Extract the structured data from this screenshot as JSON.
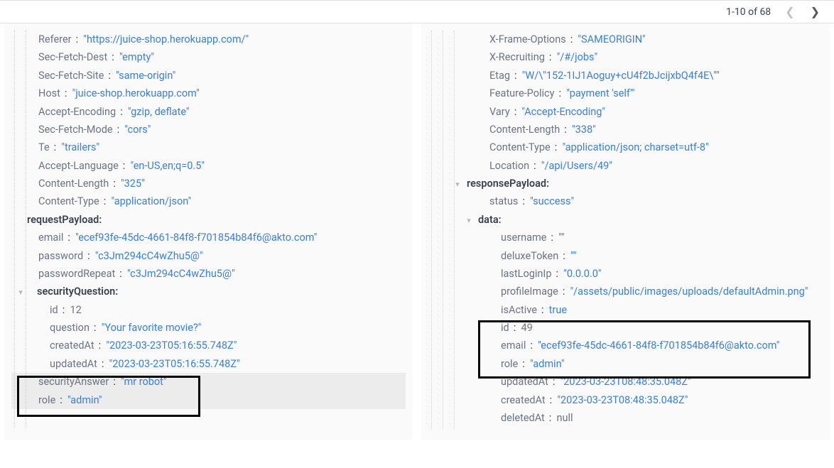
{
  "pagination": {
    "text": "1-10 of 68"
  },
  "left": {
    "headers": [
      {
        "k": "Referer",
        "v": "\"https://juice-shop.herokuapp.com/\""
      },
      {
        "k": "Sec-Fetch-Dest",
        "v": "\"empty\""
      },
      {
        "k": "Sec-Fetch-Site",
        "v": "\"same-origin\""
      },
      {
        "k": "Host",
        "v": "\"juice-shop.herokuapp.com\""
      },
      {
        "k": "Accept-Encoding",
        "v": "\"gzip, deflate\""
      },
      {
        "k": "Sec-Fetch-Mode",
        "v": "\"cors\""
      },
      {
        "k": "Te",
        "v": "\"trailers\""
      },
      {
        "k": "Accept-Language",
        "v": "\"en-US,en;q=0.5\""
      },
      {
        "k": "Content-Length",
        "v": "\"325\""
      },
      {
        "k": "Content-Type",
        "v": "\"application/json\""
      }
    ],
    "requestPayloadLabel": "requestPayload:",
    "payload": [
      {
        "k": "email",
        "v": "\"ecef93fe-45dc-4661-84f8-f701854b84f6@akto.com\""
      },
      {
        "k": "password",
        "v": "\"c3Jm294cC4wZhu5@\""
      },
      {
        "k": "passwordRepeat",
        "v": "\"c3Jm294cC4wZhu5@\""
      }
    ],
    "securityQuestionLabel": "securityQuestion:",
    "sq": {
      "id": {
        "k": "id",
        "v": "12"
      },
      "question": {
        "k": "question",
        "v": "\"Your favorite movie?\""
      },
      "createdAt": {
        "k": "createdAt",
        "v": "\"2023-03-23T05:16:55.748Z\""
      },
      "updatedAt": {
        "k": "updatedAt",
        "v": "\"2023-03-23T05:16:55.748Z\""
      }
    },
    "securityAnswer": {
      "k": "securityAnswer",
      "v": "\"mr robot\""
    },
    "role": {
      "k": "role",
      "v": "\"admin\""
    }
  },
  "right": {
    "headers": [
      {
        "k": "X-Frame-Options",
        "v": "\"SAMEORIGIN\""
      },
      {
        "k": "X-Recruiting",
        "v": "\"/#/jobs\""
      },
      {
        "k": "Etag",
        "v": "\"W/\\\"152-1IJ1Aoguy+cU4f2bJcijxbQ4f4E\\\"\""
      },
      {
        "k": "Feature-Policy",
        "v": "\"payment 'self'\""
      },
      {
        "k": "Vary",
        "v": "\"Accept-Encoding\""
      },
      {
        "k": "Content-Length",
        "v": "\"338\""
      },
      {
        "k": "Content-Type",
        "v": "\"application/json; charset=utf-8\""
      },
      {
        "k": "Location",
        "v": "\"/api/Users/49\""
      }
    ],
    "responsePayloadLabel": "responsePayload:",
    "status": {
      "k": "status",
      "v": "\"success\""
    },
    "dataLabel": "data:",
    "data": {
      "username": {
        "k": "username",
        "v": "\"\""
      },
      "deluxeToken": {
        "k": "deluxeToken",
        "v": "\"\""
      },
      "lastLoginIp": {
        "k": "lastLoginIp",
        "v": "\"0.0.0.0\""
      },
      "profileImage": {
        "k": "profileImage",
        "v": "\"/assets/public/images/uploads/defaultAdmin.png\""
      },
      "isActive": {
        "k": "isActive",
        "v": "true"
      },
      "id": {
        "k": "id",
        "v": "49"
      },
      "email": {
        "k": "email",
        "v": "\"ecef93fe-45dc-4661-84f8-f701854b84f6@akto.com\""
      },
      "role": {
        "k": "role",
        "v": "\"admin\""
      },
      "updatedAt": {
        "k": "updatedAt",
        "v": "\"2023-03-23T08:48:35.048Z\""
      },
      "createdAt": {
        "k": "createdAt",
        "v": "\"2023-03-23T08:48:35.048Z\""
      },
      "deletedAt": {
        "k": "deletedAt",
        "v": "null"
      }
    }
  }
}
